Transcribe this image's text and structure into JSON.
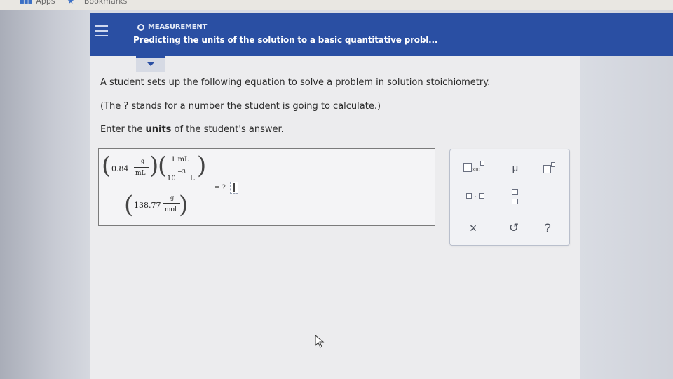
{
  "browser": {
    "apps_label": "Apps",
    "bookmarks_label": "Bookmarks"
  },
  "header": {
    "category": "MEASUREMENT",
    "title": "Predicting the units of the solution to a basic quantitative probl..."
  },
  "question": {
    "line1": "A student sets up the following equation to solve a problem in solution stoichiometry.",
    "line2": "(The ? stands for a number the student is going to calculate.)",
    "line3_prefix": "Enter the ",
    "line3_bold": "units",
    "line3_suffix": " of the student's answer."
  },
  "equation": {
    "term1_value": "0.84",
    "term1_unit_num": "g",
    "term1_unit_den": "mL",
    "term2_num": "1 mL",
    "term2_den_base": "10",
    "term2_den_exp": "−3",
    "term2_den_unit": "L",
    "denom_value": "138.77",
    "denom_unit_num": "g",
    "denom_unit_den": "mol",
    "equals_text": "= ?"
  },
  "keypad": {
    "x10_label": "×10",
    "mu_label": "μ",
    "times_label": "·",
    "clear_label": "×",
    "undo_label": "↺",
    "help_label": "?"
  },
  "colors": {
    "header_bg": "#2a4fa3",
    "content_bg": "#ececee"
  }
}
